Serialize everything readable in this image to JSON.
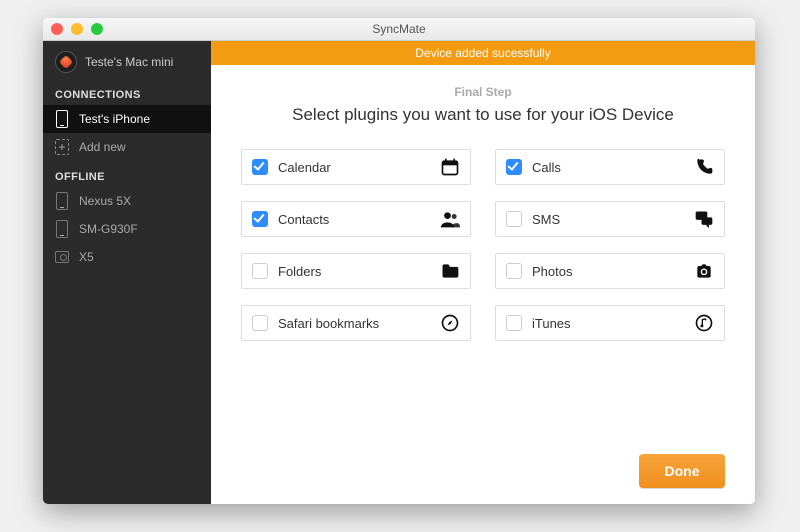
{
  "window": {
    "title": "SyncMate"
  },
  "colors": {
    "accent": "#f39c12",
    "checkbox": "#2d8cff"
  },
  "sidebar": {
    "profile_name": "Teste's Mac mini",
    "sections": {
      "connections_label": "CONNECTIONS",
      "offline_label": "OFFLINE"
    },
    "connections": [
      {
        "label": "Test's iPhone",
        "icon": "phone-icon",
        "active": true
      }
    ],
    "add_new_label": "Add new",
    "offline": [
      {
        "label": "Nexus 5X",
        "icon": "phone-icon"
      },
      {
        "label": "SM-G930F",
        "icon": "phone-icon"
      },
      {
        "label": "X5",
        "icon": "camera-icon"
      }
    ]
  },
  "main": {
    "banner": "Device added sucessfully",
    "step_label": "Final Step",
    "headline": "Select plugins you want to use for your iOS Device",
    "plugins": [
      {
        "label": "Calendar",
        "icon": "calendar-icon",
        "checked": true
      },
      {
        "label": "Calls",
        "icon": "phone-call-icon",
        "checked": true
      },
      {
        "label": "Contacts",
        "icon": "contacts-icon",
        "checked": true
      },
      {
        "label": "SMS",
        "icon": "chat-icon",
        "checked": false
      },
      {
        "label": "Folders",
        "icon": "folder-icon",
        "checked": false
      },
      {
        "label": "Photos",
        "icon": "camera-icon",
        "checked": false
      },
      {
        "label": "Safari bookmarks",
        "icon": "compass-icon",
        "checked": false
      },
      {
        "label": "iTunes",
        "icon": "music-note-icon",
        "checked": false
      }
    ],
    "done_label": "Done"
  }
}
